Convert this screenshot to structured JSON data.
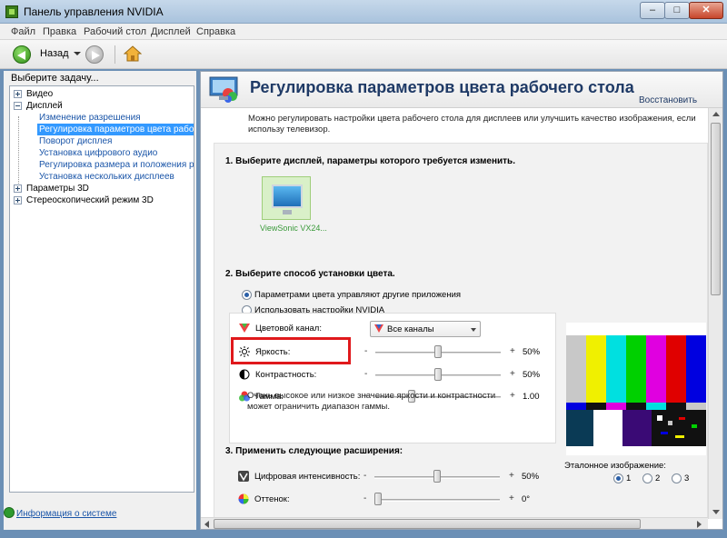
{
  "window": {
    "title": "Панель управления NVIDIA",
    "min_icon": "minimize-icon",
    "max_icon": "maximize-icon",
    "close_icon": "close-icon"
  },
  "menu": {
    "items": [
      "Файл",
      "Правка",
      "Рабочий стол",
      "Дисплей",
      "Справка"
    ]
  },
  "toolbar": {
    "back_label": "Назад",
    "back_icon": "back-arrow-icon",
    "forward_icon": "forward-arrow-icon",
    "home_icon": "home-icon"
  },
  "sidebar": {
    "prompt": "Выберите задачу...",
    "items": [
      {
        "label": "Видео",
        "level": 0,
        "expander": "plus"
      },
      {
        "label": "Дисплей",
        "level": 0,
        "expander": "minus"
      },
      {
        "label": "Изменение разрешения",
        "level": 1
      },
      {
        "label": "Регулировка параметров цвета рабочего",
        "level": 1,
        "selected": true
      },
      {
        "label": "Поворот дисплея",
        "level": 1
      },
      {
        "label": "Установка цифрового аудио",
        "level": 1
      },
      {
        "label": "Регулировка размера и положения рабо",
        "level": 1
      },
      {
        "label": "Установка нескольких дисплеев",
        "level": 1
      },
      {
        "label": "Параметры 3D",
        "level": 0,
        "expander": "plus"
      },
      {
        "label": "Стереоскопический режим 3D",
        "level": 0,
        "expander": "plus"
      }
    ],
    "system_info": "Информация о системе"
  },
  "main": {
    "title": "Регулировка параметров цвета рабочего стола",
    "restore": "Восстановить",
    "description": "Можно регулировать настройки цвета рабочего стола для дисплеев или улучшить качество изображения, если использу телевизор.",
    "section1": "1. Выберите дисплей, параметры которого требуется изменить.",
    "display_name": "ViewSonic VX24...",
    "section2": "2. Выберите способ установки цвета.",
    "radio_other_apps": "Параметрами цвета управляют другие приложения",
    "radio_nvidia": "Использовать настройки NVIDIA",
    "color_channel_label": "Цветовой канал:",
    "color_channel_value": "Все каналы",
    "brightness_label": "Яркость:",
    "brightness_value": "50%",
    "brightness_level": 0.5,
    "contrast_label": "Контрастность:",
    "contrast_value": "50%",
    "contrast_level": 0.5,
    "gamma_label": "Гамма:",
    "gamma_value": "1.00",
    "gamma_level": 0.28,
    "minus": "-",
    "plus": "+",
    "note": "Очень высокое или низкое значение яркости и контрастности может ограничить диапазон гаммы.",
    "section3": "3. Применить следующие расширения:",
    "digital_vibrance_label": "Цифровая интенсивность:",
    "digital_vibrance_value": "50%",
    "digital_vibrance_level": 0.5,
    "hue_label": "Оттенок:",
    "hue_value": "0°",
    "hue_level": 0.0,
    "reference_label": "Эталонное изображение:",
    "reference_options": [
      "1",
      "2",
      "3"
    ],
    "reference_selected": "1",
    "highlight_color": "#e0191c"
  }
}
